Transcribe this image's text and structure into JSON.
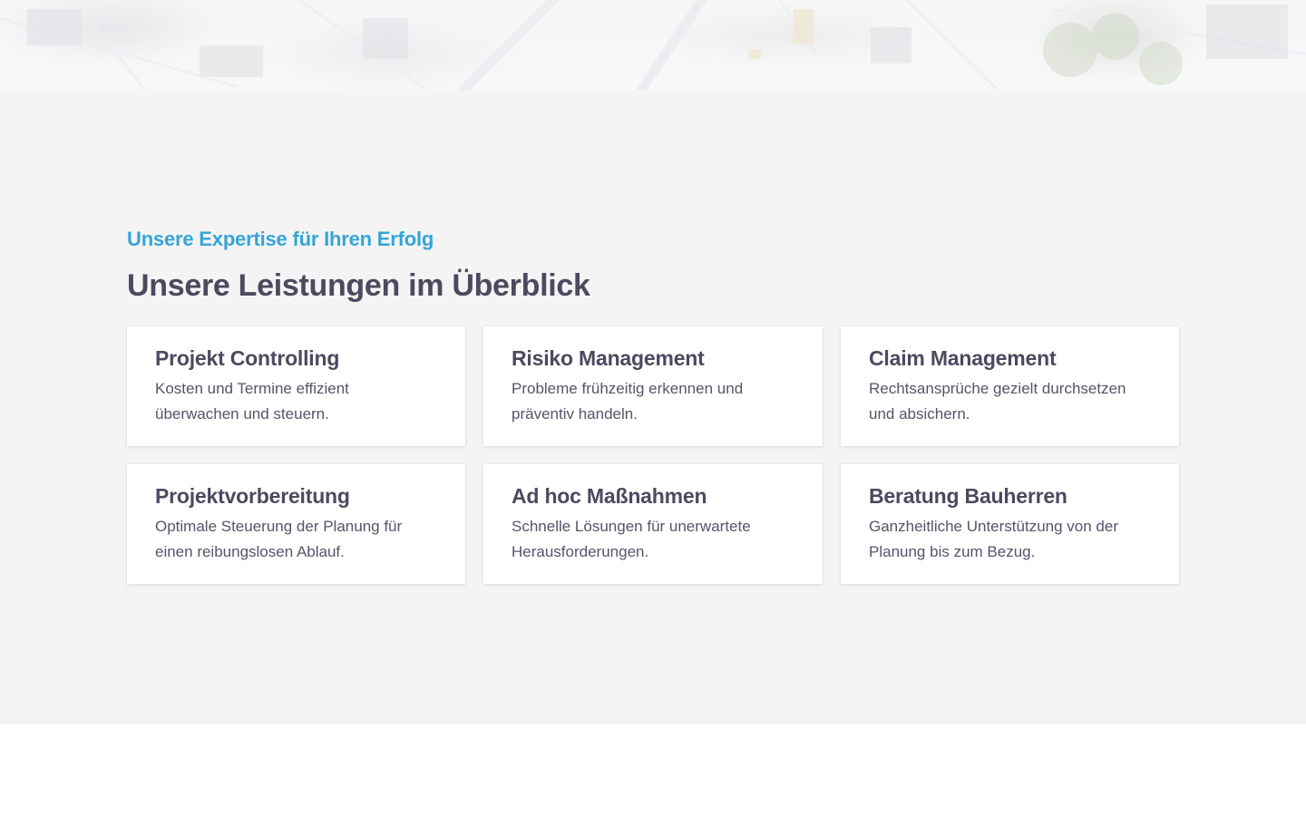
{
  "services": {
    "kicker": "Unsere Expertise für Ihren Erfolg",
    "heading": "Unsere Leistungen im Überblick",
    "cards": [
      {
        "title": "Projekt Controlling",
        "text": "Kosten und Termine effizient überwachen und steuern."
      },
      {
        "title": "Risiko Management",
        "text": "Probleme frühzeitig erkennen und präventiv handeln."
      },
      {
        "title": "Claim Management",
        "text": "Rechtsansprüche gezielt durchsetzen und absichern."
      },
      {
        "title": "Projektvorbereitung",
        "text": "Optimale Steuerung der Planung für einen reibungslosen Ablauf."
      },
      {
        "title": "Ad hoc Maßnahmen",
        "text": "Schnelle Lösungen für unerwartete Herausforderungen."
      },
      {
        "title": "Beratung Bauherren",
        "text": "Ganzheitliche Unterstützung von der Planung bis zum Bezug."
      }
    ]
  },
  "colors": {
    "accent": "#35a5d6",
    "heading": "#4b4a5f",
    "section_background": "#f4f4f4",
    "card_background": "#ffffff"
  }
}
